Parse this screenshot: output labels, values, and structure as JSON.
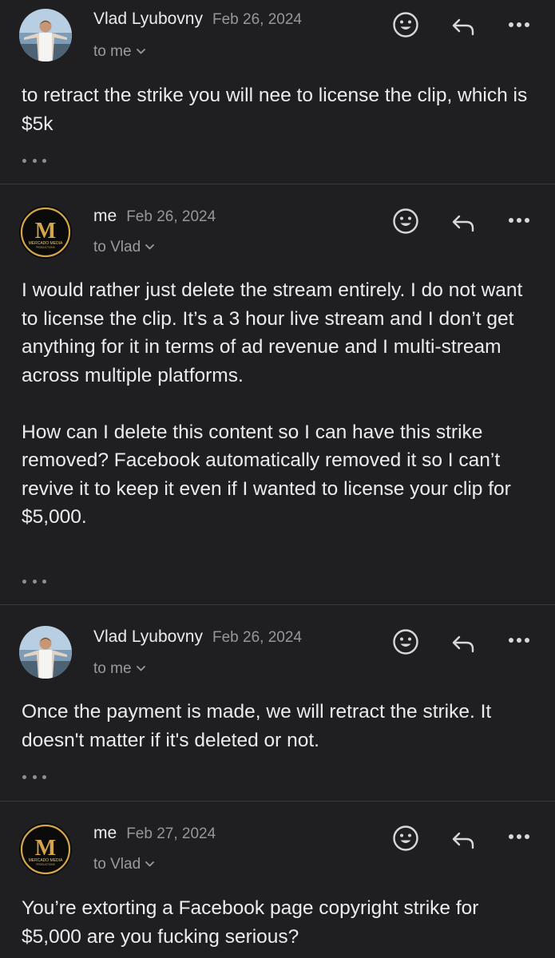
{
  "messages": [
    {
      "sender": "Vlad Lyubovny",
      "date": "Feb 26, 2024",
      "recipient": "to me",
      "avatar": "photo-avatar",
      "paragraphs": [
        "to retract the strike you will nee to license the clip, which is $5k"
      ]
    },
    {
      "sender": "me",
      "date": "Feb 26, 2024",
      "recipient": "to Vlad",
      "avatar": "mercado-media-logo",
      "paragraphs": [
        "I would rather just delete the stream entirely. I do not want to license the clip. It’s a 3 hour live stream and I don’t get anything for it in terms of ad revenue and I multi-stream across multiple platforms.",
        "How can I delete this content so I can have this strike removed? Facebook automatically removed it so I can’t revive it to keep it even if I wanted to license your clip for $5,000."
      ]
    },
    {
      "sender": "Vlad Lyubovny",
      "date": "Feb 26, 2024",
      "recipient": "to me",
      "avatar": "photo-avatar",
      "paragraphs": [
        "Once the payment is made, we will retract the strike.  It doesn't matter if it's deleted or not."
      ]
    },
    {
      "sender": "me",
      "date": "Feb 27, 2024",
      "recipient": "to Vlad",
      "avatar": "mercado-media-logo",
      "paragraphs": [
        "You’re extorting a Facebook page copyright strike for $5,000 are you fucking serious?"
      ]
    }
  ],
  "logo": {
    "letter": "M",
    "line1": "MERCADO MEDIA",
    "line2": "PRODUCTIONS"
  },
  "icons": {
    "emoji": "emoji-reaction-icon",
    "reply": "reply-icon",
    "more": "more-options-icon",
    "expand": "show-trimmed-content-icon",
    "chevron": "chevron-down-icon"
  },
  "colors": {
    "background": "#1f1f21",
    "text": "#ececee",
    "secondary": "#96969c",
    "divider": "#3a3a3e",
    "gold": "#d4a64a"
  }
}
